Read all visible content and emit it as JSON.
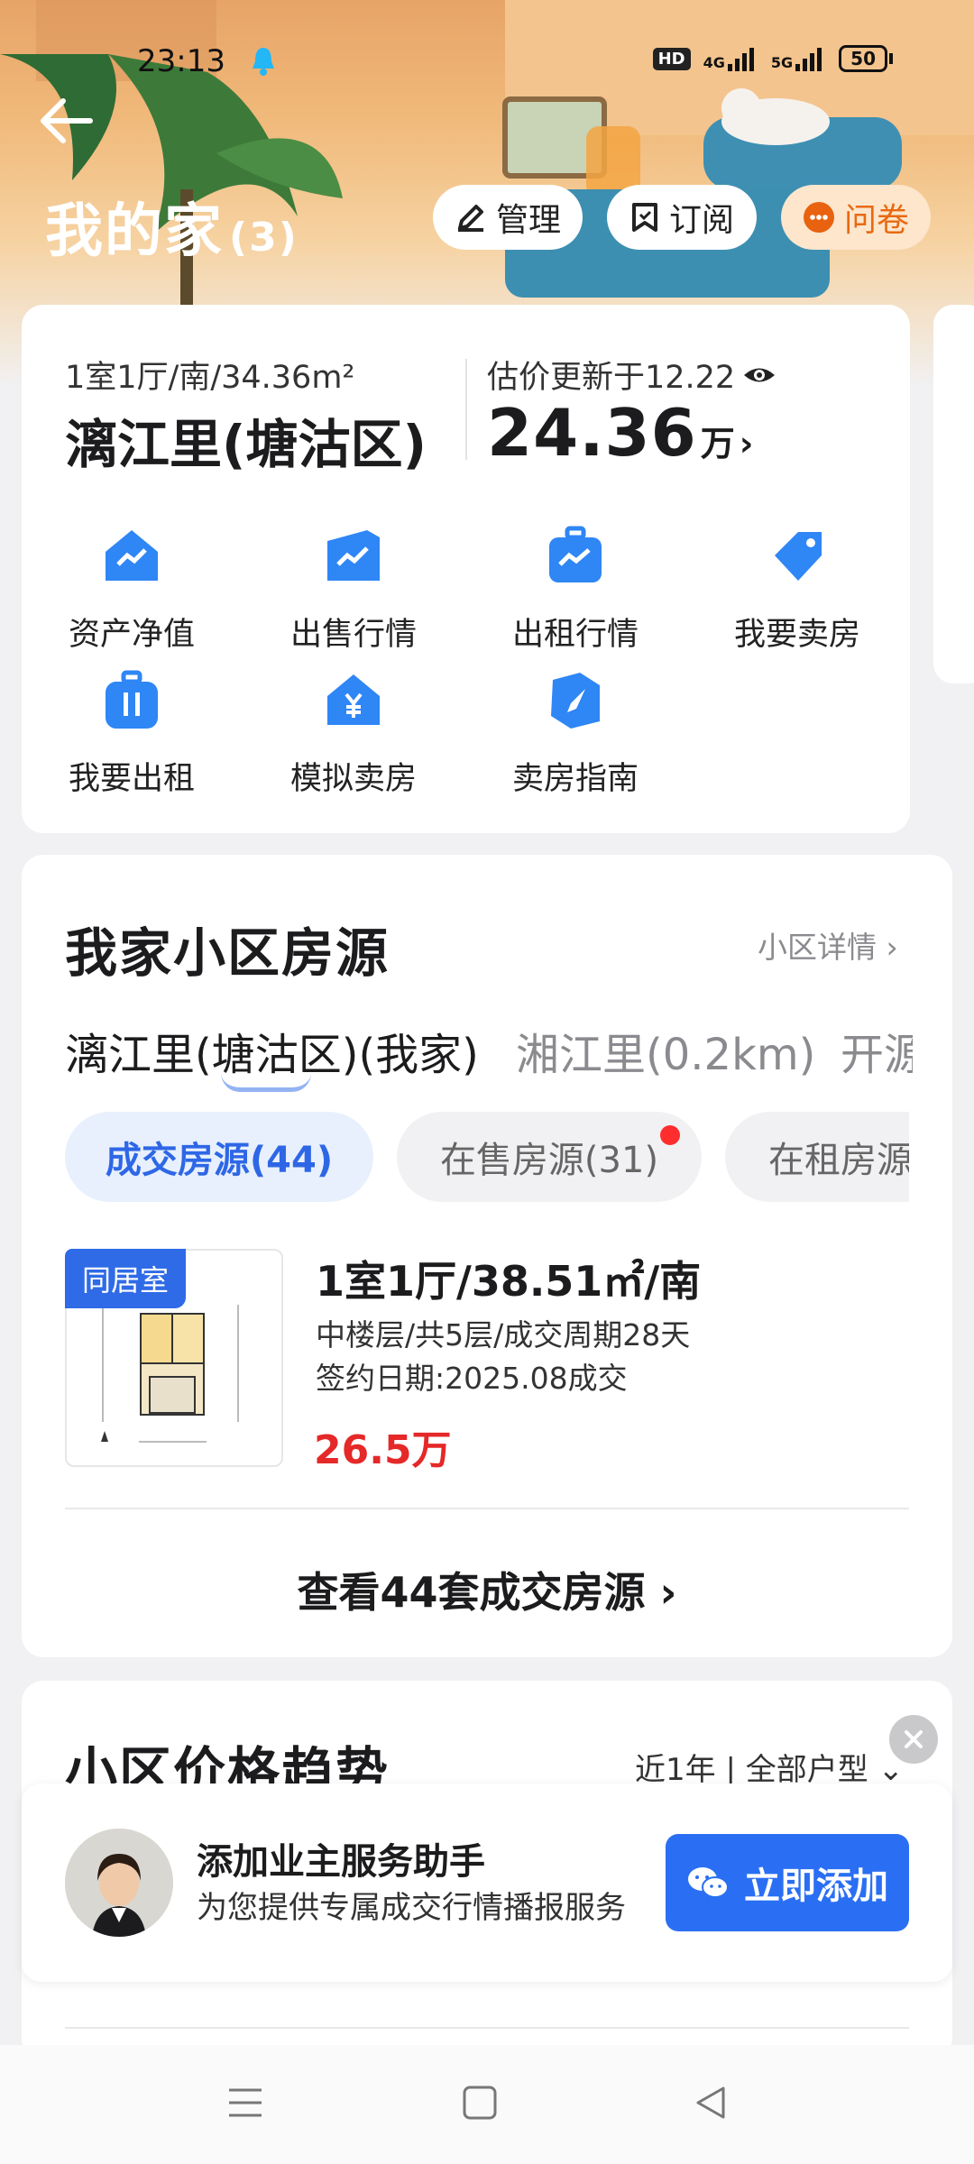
{
  "status_bar": {
    "time": "23:13",
    "hd_label": "HD",
    "net1": "4G",
    "net2": "5G",
    "battery": "50"
  },
  "header": {
    "title": "我的家",
    "count": "(3)",
    "manage": "管理",
    "subscribe": "订阅",
    "survey": "问卷"
  },
  "home_card": {
    "layout": "1室1厅/南/34.36m²",
    "name": "漓江里(塘沽区)",
    "estimate_label": "估价更新于12.22",
    "price": "24.36",
    "unit": "万",
    "shortcuts": [
      "资产净值",
      "出售行情",
      "出租行情",
      "我要卖房",
      "我要出租",
      "模拟卖房",
      "卖房指南"
    ]
  },
  "listings": {
    "title": "我家小区房源",
    "details": "小区详情",
    "tabs": [
      "漓江里(塘沽区)(我家)",
      "湘江里(0.2km)",
      "开源"
    ],
    "chips": [
      "成交房源(44)",
      "在售房源(31)",
      "在租房源"
    ],
    "item": {
      "badge": "同居室",
      "title": "1室1厅/38.51㎡/南",
      "detail1": "中楼层/共5层/成交周期28天",
      "detail2": "签约日期:2025.08成交",
      "price": "26.5万"
    },
    "view_all": "查看44套成交房源"
  },
  "trend": {
    "title": "小区价格趋势",
    "filter1": "近1年",
    "filter2": "全部户型"
  },
  "assistant": {
    "title": "添加业主服务助手",
    "subtitle": "为您提供专属成交行情播报服务",
    "button": "立即添加"
  },
  "colors": {
    "accent": "#2e67e6",
    "price_red": "#e52828",
    "survey_orange": "#e86a12"
  }
}
